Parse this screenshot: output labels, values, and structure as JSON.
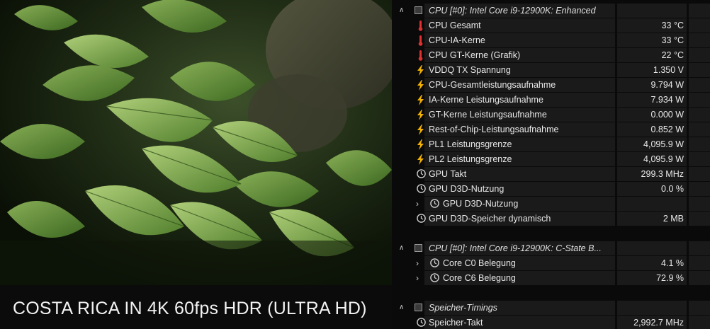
{
  "video": {
    "title": "COSTA RICA IN 4K 60fps HDR (ULTRA HD)"
  },
  "colors": {
    "temp": "#e03030",
    "power": "#f2b100",
    "clock": "#cfcfcf",
    "row_bg": "#1a1a1a",
    "panel_bg": "#0a0a0a"
  },
  "sensor_groups": [
    {
      "title": "CPU [#0]: Intel Core i9-12900K: Enhanced",
      "rows": [
        {
          "label": "CPU Gesamt",
          "value": "33 °C",
          "icon": "thermometer-icon"
        },
        {
          "label": "CPU-IA-Kerne",
          "value": "33 °C",
          "icon": "thermometer-icon"
        },
        {
          "label": "CPU GT-Kerne (Grafik)",
          "value": "22 °C",
          "icon": "thermometer-icon"
        },
        {
          "label": "VDDQ TX Spannung",
          "value": "1.350 V",
          "icon": "lightning-icon"
        },
        {
          "label": "CPU-Gesamtleistungsaufnahme",
          "value": "9.794 W",
          "icon": "lightning-icon"
        },
        {
          "label": "IA-Kerne Leistungsaufnahme",
          "value": "7.934 W",
          "icon": "lightning-icon"
        },
        {
          "label": "GT-Kerne Leistungsaufnahme",
          "value": "0.000 W",
          "icon": "lightning-icon"
        },
        {
          "label": "Rest-of-Chip-Leistungsaufnahme",
          "value": "0.852 W",
          "icon": "lightning-icon"
        },
        {
          "label": "PL1 Leistungsgrenze",
          "value": "4,095.9 W",
          "icon": "lightning-icon"
        },
        {
          "label": "PL2 Leistungsgrenze",
          "value": "4,095.9 W",
          "icon": "lightning-icon"
        },
        {
          "label": "GPU Takt",
          "value": "299.3 MHz",
          "icon": "clock-icon"
        },
        {
          "label": "GPU D3D-Nutzung",
          "value": "0.0 %",
          "icon": "clock-icon"
        },
        {
          "label": "GPU D3D-Nutzung",
          "value": "",
          "icon": "clock-icon",
          "expandable": true
        },
        {
          "label": "GPU D3D-Speicher dynamisch",
          "value": "2 MB",
          "icon": "clock-icon"
        }
      ]
    },
    {
      "title": "CPU [#0]: Intel Core i9-12900K: C-State B...",
      "rows": [
        {
          "label": "Core C0 Belegung",
          "value": "4.1 %",
          "icon": "clock-icon",
          "expandable": true
        },
        {
          "label": "Core C6 Belegung",
          "value": "72.9 %",
          "icon": "clock-icon",
          "expandable": true
        }
      ]
    },
    {
      "title": "Speicher-Timings",
      "rows": [
        {
          "label": "Speicher-Takt",
          "value": "2,992.7 MHz",
          "icon": "clock-icon"
        }
      ]
    }
  ]
}
